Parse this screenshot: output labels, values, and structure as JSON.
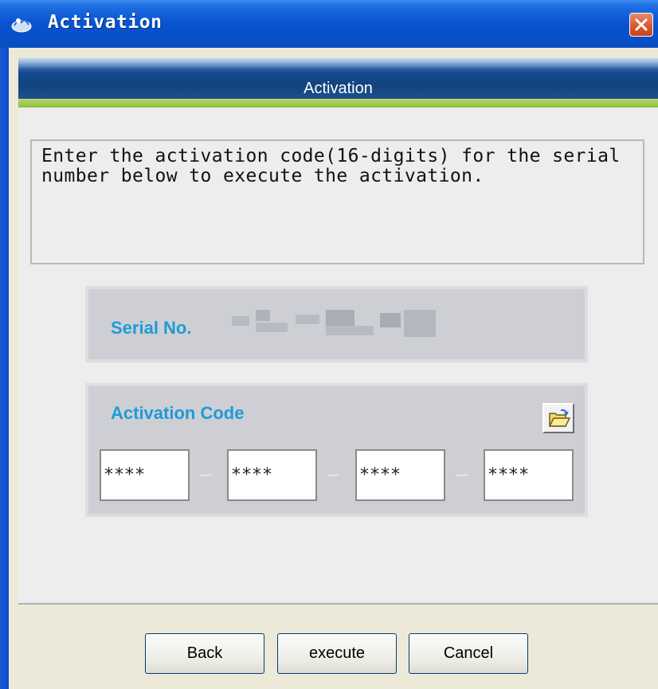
{
  "window": {
    "title": "Activation",
    "close_label": "Close"
  },
  "banner": {
    "title": "Activation"
  },
  "description": {
    "text": "Enter the activation code(16-digits) for the serial number below to execute the activation."
  },
  "serial": {
    "label": "Serial No."
  },
  "activation_code": {
    "label": "Activation Code",
    "fields": [
      "****",
      "****",
      "****",
      "****"
    ],
    "separator": "–"
  },
  "buttons": {
    "back": "Back",
    "execute": "execute",
    "cancel": "Cancel"
  },
  "icons": {
    "app": "app-logo-icon",
    "close": "close-icon",
    "open_folder": "open-folder-icon"
  },
  "colors": {
    "title_bar": "#0a55d2",
    "accent_label": "#1e9ad6",
    "green_strip": "#8cbf3e",
    "close_button": "#d7572f"
  }
}
